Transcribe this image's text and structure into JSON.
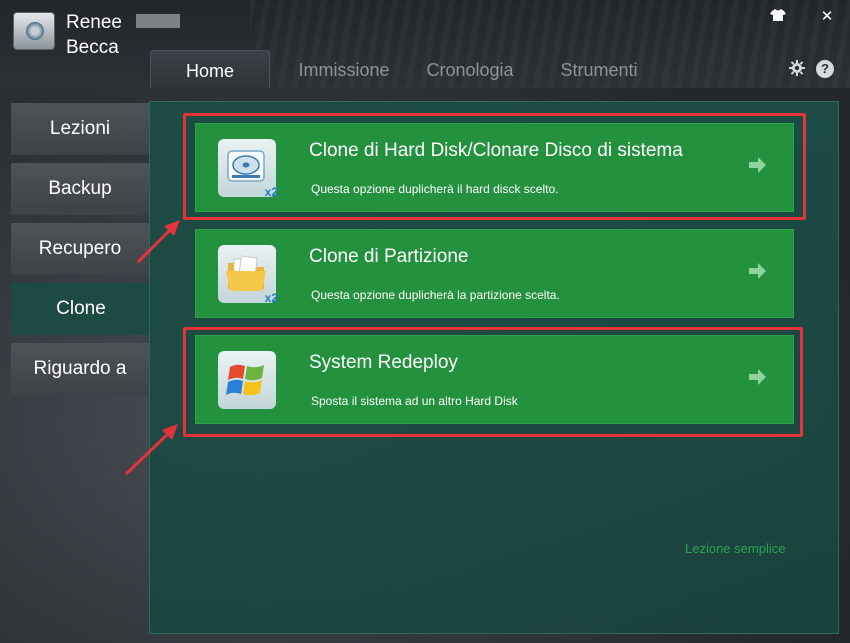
{
  "app": {
    "brand_line1": "Renee",
    "brand_line2": "Becca"
  },
  "window_controls": {
    "skin_icon": "tshirt-icon",
    "close_icon": "close-icon",
    "close_label": "✕"
  },
  "tabs": [
    {
      "label": "Home",
      "active": true
    },
    {
      "label": "Immissione",
      "active": false
    },
    {
      "label": "Cronologia",
      "active": false
    },
    {
      "label": "Strumenti",
      "active": false
    }
  ],
  "header_icons": {
    "settings": "gear-icon",
    "help": "help-icon",
    "help_label": "?"
  },
  "sidebar": {
    "items": [
      {
        "label": "Lezioni",
        "active": false
      },
      {
        "label": "Backup",
        "active": false
      },
      {
        "label": "Recupero",
        "active": false
      },
      {
        "label": "Clone",
        "active": true
      },
      {
        "label": "Riguardo a",
        "active": false
      }
    ]
  },
  "cards": [
    {
      "title": "Clone di Hard Disk/Clonare Disco di sistema",
      "description": "Questa opzione duplicherà il hard disck scelto.",
      "icon": "hard-disk-clone-icon",
      "badge": "x2",
      "highlighted": true
    },
    {
      "title": "Clone di Partizione",
      "description": "Questa opzione duplicherà la partizione scelta.",
      "icon": "folder-clone-icon",
      "badge": "x2",
      "highlighted": false
    },
    {
      "title": "System Redeploy",
      "description": "Sposta il sistema ad un altro Hard Disk",
      "icon": "windows-logo-icon",
      "badge": "",
      "highlighted": true
    }
  ],
  "footer": {
    "simple_mode_link": "Lezione semplice"
  },
  "colors": {
    "card_green": "#24913f",
    "highlight_red": "#e4343a",
    "panel_teal": "#1e4a44",
    "link_green": "#2ea354"
  }
}
